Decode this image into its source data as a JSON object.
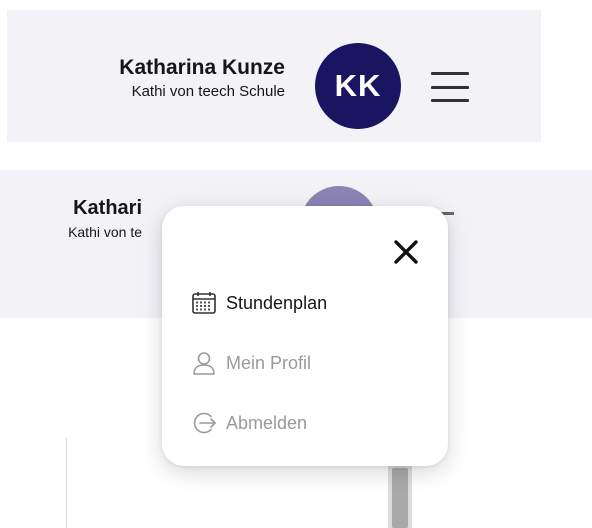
{
  "header": {
    "user_name": "Katharina Kunze",
    "school": "Kathi von teech Schule",
    "avatar_initials": "KK",
    "menu_icon": "hamburger-menu-icon"
  },
  "header_open": {
    "user_name_visible": "Kathari",
    "school_visible": "Kathi von te"
  },
  "menu": {
    "close_icon": "close-icon",
    "items": [
      {
        "label": "Stundenplan",
        "icon": "calendar-icon",
        "state": "enabled"
      },
      {
        "label": "Mein Profil",
        "icon": "user-icon",
        "state": "disabled"
      },
      {
        "label": "Abmelden",
        "icon": "logout-icon",
        "state": "disabled"
      }
    ]
  },
  "colors": {
    "avatar_bg": "#1a1560",
    "header_bg": "#f3f2f7",
    "text_dark": "#161616",
    "text_muted": "#9a9a9a"
  }
}
